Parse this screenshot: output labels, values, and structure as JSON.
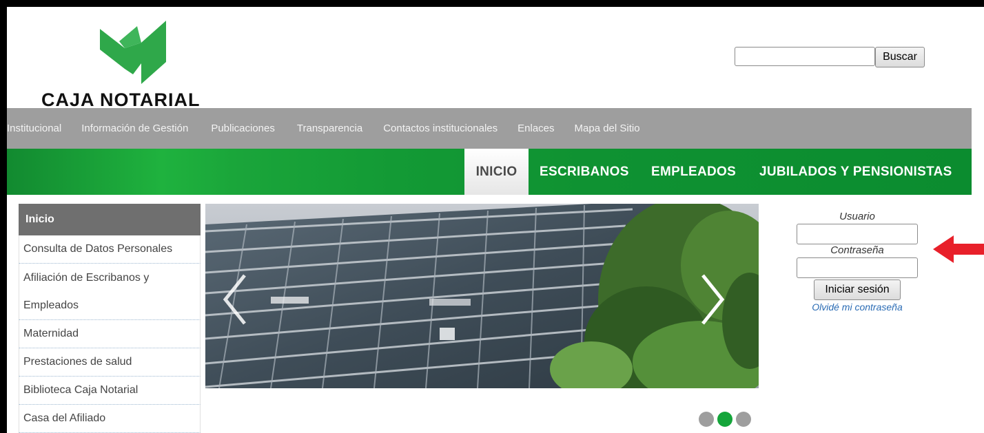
{
  "header": {
    "logo_text": "CAJA NOTARIAL",
    "search_button": "Buscar",
    "search_value": ""
  },
  "top_nav": {
    "items": [
      {
        "label": "Institucional"
      },
      {
        "label": "Información de Gestión"
      },
      {
        "label": "Publicaciones"
      },
      {
        "label": "Transparencia"
      },
      {
        "label": "Contactos institucionales"
      },
      {
        "label": "Enlaces"
      },
      {
        "label": "Mapa del Sitio"
      }
    ]
  },
  "main_tabs": {
    "items": [
      {
        "label": "INICIO",
        "active": true
      },
      {
        "label": "ESCRIBANOS",
        "active": false
      },
      {
        "label": "EMPLEADOS",
        "active": false
      },
      {
        "label": "JUBILADOS Y PENSIONISTAS",
        "active": false
      }
    ]
  },
  "sidebar": {
    "title": "Inicio",
    "items": [
      {
        "label": "Consulta de Datos Personales"
      },
      {
        "label": "Afiliación de Escribanos y"
      },
      {
        "label": "Empleados"
      },
      {
        "label": "Maternidad"
      },
      {
        "label": "Prestaciones de salud"
      },
      {
        "label": "Biblioteca Caja Notarial"
      },
      {
        "label": "Casa del Afiliado"
      }
    ]
  },
  "slider": {
    "prev_icon": "chevron-left-icon",
    "next_icon": "chevron-right-icon",
    "dots": {
      "count": 3,
      "active_index": 1
    }
  },
  "login": {
    "user_label": "Usuario",
    "password_label": "Contraseña",
    "button": "Iniciar sesión",
    "forgot_link": "Olvidé mi contraseña",
    "user_value": "",
    "password_value": ""
  },
  "colors": {
    "brand_green": "#14a53a",
    "nav_gray": "#9e9e9e",
    "sidebar_head": "#6f6f6f",
    "annotation_arrow": "#e8202a",
    "link_blue": "#2a6bb4"
  }
}
